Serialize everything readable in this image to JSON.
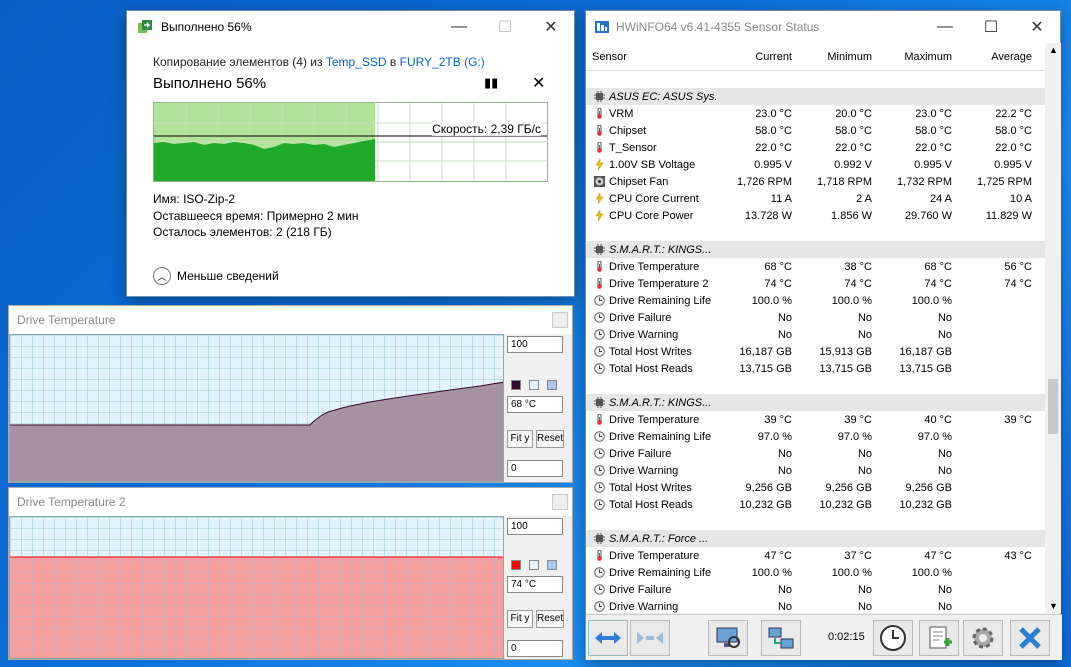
{
  "copy_dialog": {
    "title": "Выполнено 56%",
    "line_prefix": "Копирование элементов (4) из",
    "source": "Temp_SSD",
    "in_word": "в",
    "dest": "FURY_2TB (G:)",
    "heading": "Выполнено 56%",
    "speed": "Скорость: 2,39 ГБ/с",
    "progress": 0.56,
    "name_label": "Имя:",
    "name_value": "ISO-Zip-2",
    "time_label": "Оставшееся время:",
    "time_value": "Примерно 2 мин",
    "items_label": "Осталось элементов:",
    "items_value": "2 (218 ГБ)",
    "toggle_label": "Меньше сведений"
  },
  "graph1": {
    "title": "Drive Temperature",
    "max": "100",
    "current": "68 °C",
    "min": "0",
    "fit_label": "Fit y",
    "reset_label": "Reset",
    "color": "#3a0a2e"
  },
  "graph2": {
    "title": "Drive Temperature 2",
    "max": "100",
    "current": "74 °C",
    "min": "0",
    "fit_label": "Fit y",
    "reset_label": "Reset",
    "color": "#ff0000"
  },
  "hwinfo": {
    "title": "HWiNFO64 v6.41-4355 Sensor Status",
    "headers": [
      "Sensor",
      "Current",
      "Minimum",
      "Maximum",
      "Average"
    ],
    "time": "0:02:15",
    "rows": [
      {
        "type": "blank"
      },
      {
        "type": "group",
        "name": "ASUS EC: ASUS Sys..."
      },
      {
        "type": "data",
        "icon": "thermometer",
        "name": "VRM",
        "cur": "23.0 °C",
        "min": "20.0 °C",
        "max": "23.0 °C",
        "avg": "22.2 °C"
      },
      {
        "type": "data",
        "icon": "thermometer",
        "name": "Chipset",
        "cur": "58.0 °C",
        "min": "58.0 °C",
        "max": "58.0 °C",
        "avg": "58.0 °C"
      },
      {
        "type": "data",
        "icon": "thermometer",
        "name": "T_Sensor",
        "cur": "22.0 °C",
        "min": "22.0 °C",
        "max": "22.0 °C",
        "avg": "22.0 °C"
      },
      {
        "type": "data",
        "icon": "bolt",
        "name": "1.00V SB Voltage",
        "cur": "0.995 V",
        "min": "0.992 V",
        "max": "0.995 V",
        "avg": "0.995 V"
      },
      {
        "type": "data",
        "icon": "fan",
        "name": "Chipset Fan",
        "cur": "1,726 RPM",
        "min": "1,718 RPM",
        "max": "1,732 RPM",
        "avg": "1,725 RPM"
      },
      {
        "type": "data",
        "icon": "bolt",
        "name": "CPU Core Current",
        "cur": "11 A",
        "min": "2 A",
        "max": "24 A",
        "avg": "10 A"
      },
      {
        "type": "data",
        "icon": "bolt",
        "name": "CPU Core Power",
        "cur": "13.728 W",
        "min": "1.856 W",
        "max": "29.760 W",
        "avg": "11.829 W"
      },
      {
        "type": "blank"
      },
      {
        "type": "group",
        "name": "S.M.A.R.T.: KINGS..."
      },
      {
        "type": "data",
        "icon": "thermometer",
        "name": "Drive Temperature",
        "cur": "68 °C",
        "min": "38 °C",
        "max": "68 °C",
        "avg": "56 °C"
      },
      {
        "type": "data",
        "icon": "thermometer",
        "name": "Drive Temperature 2",
        "cur": "74 °C",
        "min": "74 °C",
        "max": "74 °C",
        "avg": "74 °C"
      },
      {
        "type": "data",
        "icon": "clock",
        "name": "Drive Remaining Life",
        "cur": "100.0 %",
        "min": "100.0 %",
        "max": "100.0 %",
        "avg": ""
      },
      {
        "type": "data",
        "icon": "clock",
        "name": "Drive Failure",
        "cur": "No",
        "min": "No",
        "max": "No",
        "avg": ""
      },
      {
        "type": "data",
        "icon": "clock",
        "name": "Drive Warning",
        "cur": "No",
        "min": "No",
        "max": "No",
        "avg": ""
      },
      {
        "type": "data",
        "icon": "clock",
        "name": "Total Host Writes",
        "cur": "16,187 GB",
        "min": "15,913 GB",
        "max": "16,187 GB",
        "avg": ""
      },
      {
        "type": "data",
        "icon": "clock",
        "name": "Total Host Reads",
        "cur": "13,715 GB",
        "min": "13,715 GB",
        "max": "13,715 GB",
        "avg": ""
      },
      {
        "type": "blank"
      },
      {
        "type": "group",
        "name": "S.M.A.R.T.: KINGS..."
      },
      {
        "type": "data",
        "icon": "thermometer",
        "name": "Drive Temperature",
        "cur": "39 °C",
        "min": "39 °C",
        "max": "40 °C",
        "avg": "39 °C"
      },
      {
        "type": "data",
        "icon": "clock",
        "name": "Drive Remaining Life",
        "cur": "97.0 %",
        "min": "97.0 %",
        "max": "97.0 %",
        "avg": ""
      },
      {
        "type": "data",
        "icon": "clock",
        "name": "Drive Failure",
        "cur": "No",
        "min": "No",
        "max": "No",
        "avg": ""
      },
      {
        "type": "data",
        "icon": "clock",
        "name": "Drive Warning",
        "cur": "No",
        "min": "No",
        "max": "No",
        "avg": ""
      },
      {
        "type": "data",
        "icon": "clock",
        "name": "Total Host Writes",
        "cur": "9,256 GB",
        "min": "9,256 GB",
        "max": "9,256 GB",
        "avg": ""
      },
      {
        "type": "data",
        "icon": "clock",
        "name": "Total Host Reads",
        "cur": "10,232 GB",
        "min": "10,232 GB",
        "max": "10,232 GB",
        "avg": ""
      },
      {
        "type": "blank"
      },
      {
        "type": "group",
        "name": "S.M.A.R.T.: Force ..."
      },
      {
        "type": "data",
        "icon": "thermometer",
        "name": "Drive Temperature",
        "cur": "47 °C",
        "min": "37 °C",
        "max": "47 °C",
        "avg": "43 °C"
      },
      {
        "type": "data",
        "icon": "clock",
        "name": "Drive Remaining Life",
        "cur": "100.0 %",
        "min": "100.0 %",
        "max": "100.0 %",
        "avg": ""
      },
      {
        "type": "data",
        "icon": "clock",
        "name": "Drive Failure",
        "cur": "No",
        "min": "No",
        "max": "No",
        "avg": ""
      },
      {
        "type": "data",
        "icon": "clock",
        "name": "Drive Warning",
        "cur": "No",
        "min": "No",
        "max": "No",
        "avg": ""
      }
    ]
  }
}
